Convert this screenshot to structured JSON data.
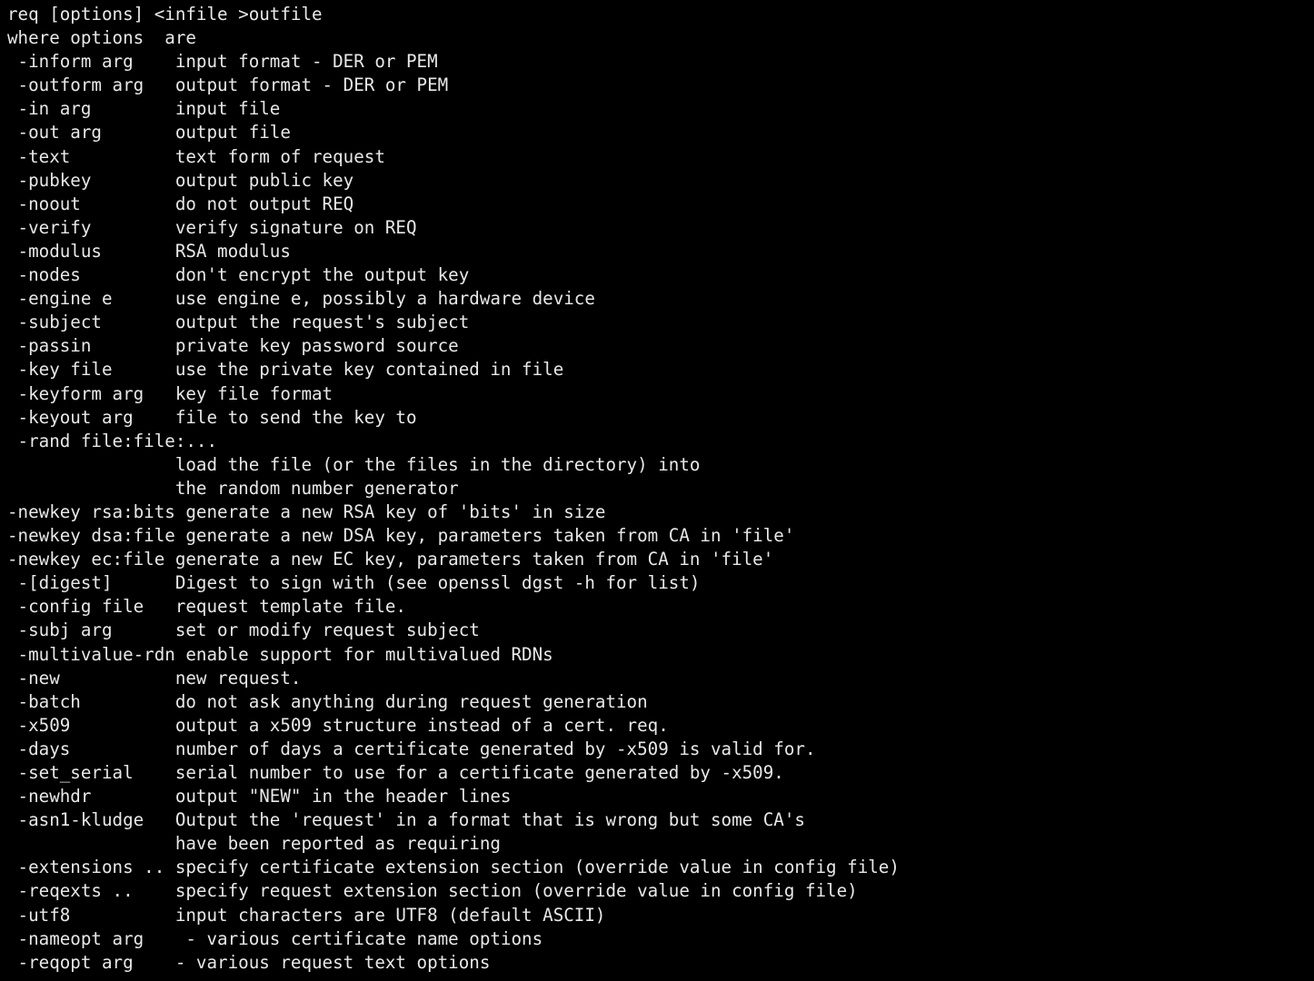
{
  "terminal": {
    "title": "openssl req help output",
    "background_color": "#000000",
    "text_color": "#e8e8e8",
    "font_family_kind": "monospace",
    "usage_line": "req [options] <infile >outfile",
    "options_header": "where options  are",
    "lines": [
      "req [options] <infile >outfile",
      "where options  are",
      " -inform arg    input format - DER or PEM",
      " -outform arg   output format - DER or PEM",
      " -in arg        input file",
      " -out arg       output file",
      " -text          text form of request",
      " -pubkey        output public key",
      " -noout         do not output REQ",
      " -verify        verify signature on REQ",
      " -modulus       RSA modulus",
      " -nodes         don't encrypt the output key",
      " -engine e      use engine e, possibly a hardware device",
      " -subject       output the request's subject",
      " -passin        private key password source",
      " -key file      use the private key contained in file",
      " -keyform arg   key file format",
      " -keyout arg    file to send the key to",
      " -rand file:file:...",
      "                load the file (or the files in the directory) into",
      "                the random number generator",
      "-newkey rsa:bits generate a new RSA key of 'bits' in size",
      "-newkey dsa:file generate a new DSA key, parameters taken from CA in 'file'",
      "-newkey ec:file generate a new EC key, parameters taken from CA in 'file'",
      " -[digest]      Digest to sign with (see openssl dgst -h for list)",
      " -config file   request template file.",
      " -subj arg      set or modify request subject",
      " -multivalue-rdn enable support for multivalued RDNs",
      " -new           new request.",
      " -batch         do not ask anything during request generation",
      " -x509          output a x509 structure instead of a cert. req.",
      " -days          number of days a certificate generated by -x509 is valid for.",
      " -set_serial    serial number to use for a certificate generated by -x509.",
      " -newhdr        output \"NEW\" in the header lines",
      " -asn1-kludge   Output the 'request' in a format that is wrong but some CA's",
      "                have been reported as requiring",
      " -extensions .. specify certificate extension section (override value in config file)",
      " -reqexts ..    specify request extension section (override value in config file)",
      " -utf8          input characters are UTF8 (default ASCII)",
      " -nameopt arg    - various certificate name options",
      " -reqopt arg    - various request text options"
    ],
    "options": [
      {
        "flag": "-inform arg",
        "description": "input format - DER or PEM"
      },
      {
        "flag": "-outform arg",
        "description": "output format - DER or PEM"
      },
      {
        "flag": "-in arg",
        "description": "input file"
      },
      {
        "flag": "-out arg",
        "description": "output file"
      },
      {
        "flag": "-text",
        "description": "text form of request"
      },
      {
        "flag": "-pubkey",
        "description": "output public key"
      },
      {
        "flag": "-noout",
        "description": "do not output REQ"
      },
      {
        "flag": "-verify",
        "description": "verify signature on REQ"
      },
      {
        "flag": "-modulus",
        "description": "RSA modulus"
      },
      {
        "flag": "-nodes",
        "description": "don't encrypt the output key"
      },
      {
        "flag": "-engine e",
        "description": "use engine e, possibly a hardware device"
      },
      {
        "flag": "-subject",
        "description": "output the request's subject"
      },
      {
        "flag": "-passin",
        "description": "private key password source"
      },
      {
        "flag": "-key file",
        "description": "use the private key contained in file"
      },
      {
        "flag": "-keyform arg",
        "description": "key file format"
      },
      {
        "flag": "-keyout arg",
        "description": "file to send the key to"
      },
      {
        "flag": "-rand file:file:...",
        "description": "load the file (or the files in the directory) into the random number generator"
      },
      {
        "flag": "-newkey rsa:bits",
        "description": "generate a new RSA key of 'bits' in size"
      },
      {
        "flag": "-newkey dsa:file",
        "description": "generate a new DSA key, parameters taken from CA in 'file'"
      },
      {
        "flag": "-newkey ec:file",
        "description": "generate a new EC key, parameters taken from CA in 'file'"
      },
      {
        "flag": "-[digest]",
        "description": "Digest to sign with (see openssl dgst -h for list)"
      },
      {
        "flag": "-config file",
        "description": "request template file."
      },
      {
        "flag": "-subj arg",
        "description": "set or modify request subject"
      },
      {
        "flag": "-multivalue-rdn",
        "description": "enable support for multivalued RDNs"
      },
      {
        "flag": "-new",
        "description": "new request."
      },
      {
        "flag": "-batch",
        "description": "do not ask anything during request generation"
      },
      {
        "flag": "-x509",
        "description": "output a x509 structure instead of a cert. req."
      },
      {
        "flag": "-days",
        "description": "number of days a certificate generated by -x509 is valid for."
      },
      {
        "flag": "-set_serial",
        "description": "serial number to use for a certificate generated by -x509."
      },
      {
        "flag": "-newhdr",
        "description": "output \"NEW\" in the header lines"
      },
      {
        "flag": "-asn1-kludge",
        "description": "Output the 'request' in a format that is wrong but some CA's have been reported as requiring"
      },
      {
        "flag": "-extensions ..",
        "description": "specify certificate extension section (override value in config file)"
      },
      {
        "flag": "-reqexts ..",
        "description": "specify request extension section (override value in config file)"
      },
      {
        "flag": "-utf8",
        "description": "input characters are UTF8 (default ASCII)"
      },
      {
        "flag": "-nameopt arg",
        "description": "- various certificate name options"
      },
      {
        "flag": "-reqopt arg",
        "description": "- various request text options"
      }
    ]
  }
}
